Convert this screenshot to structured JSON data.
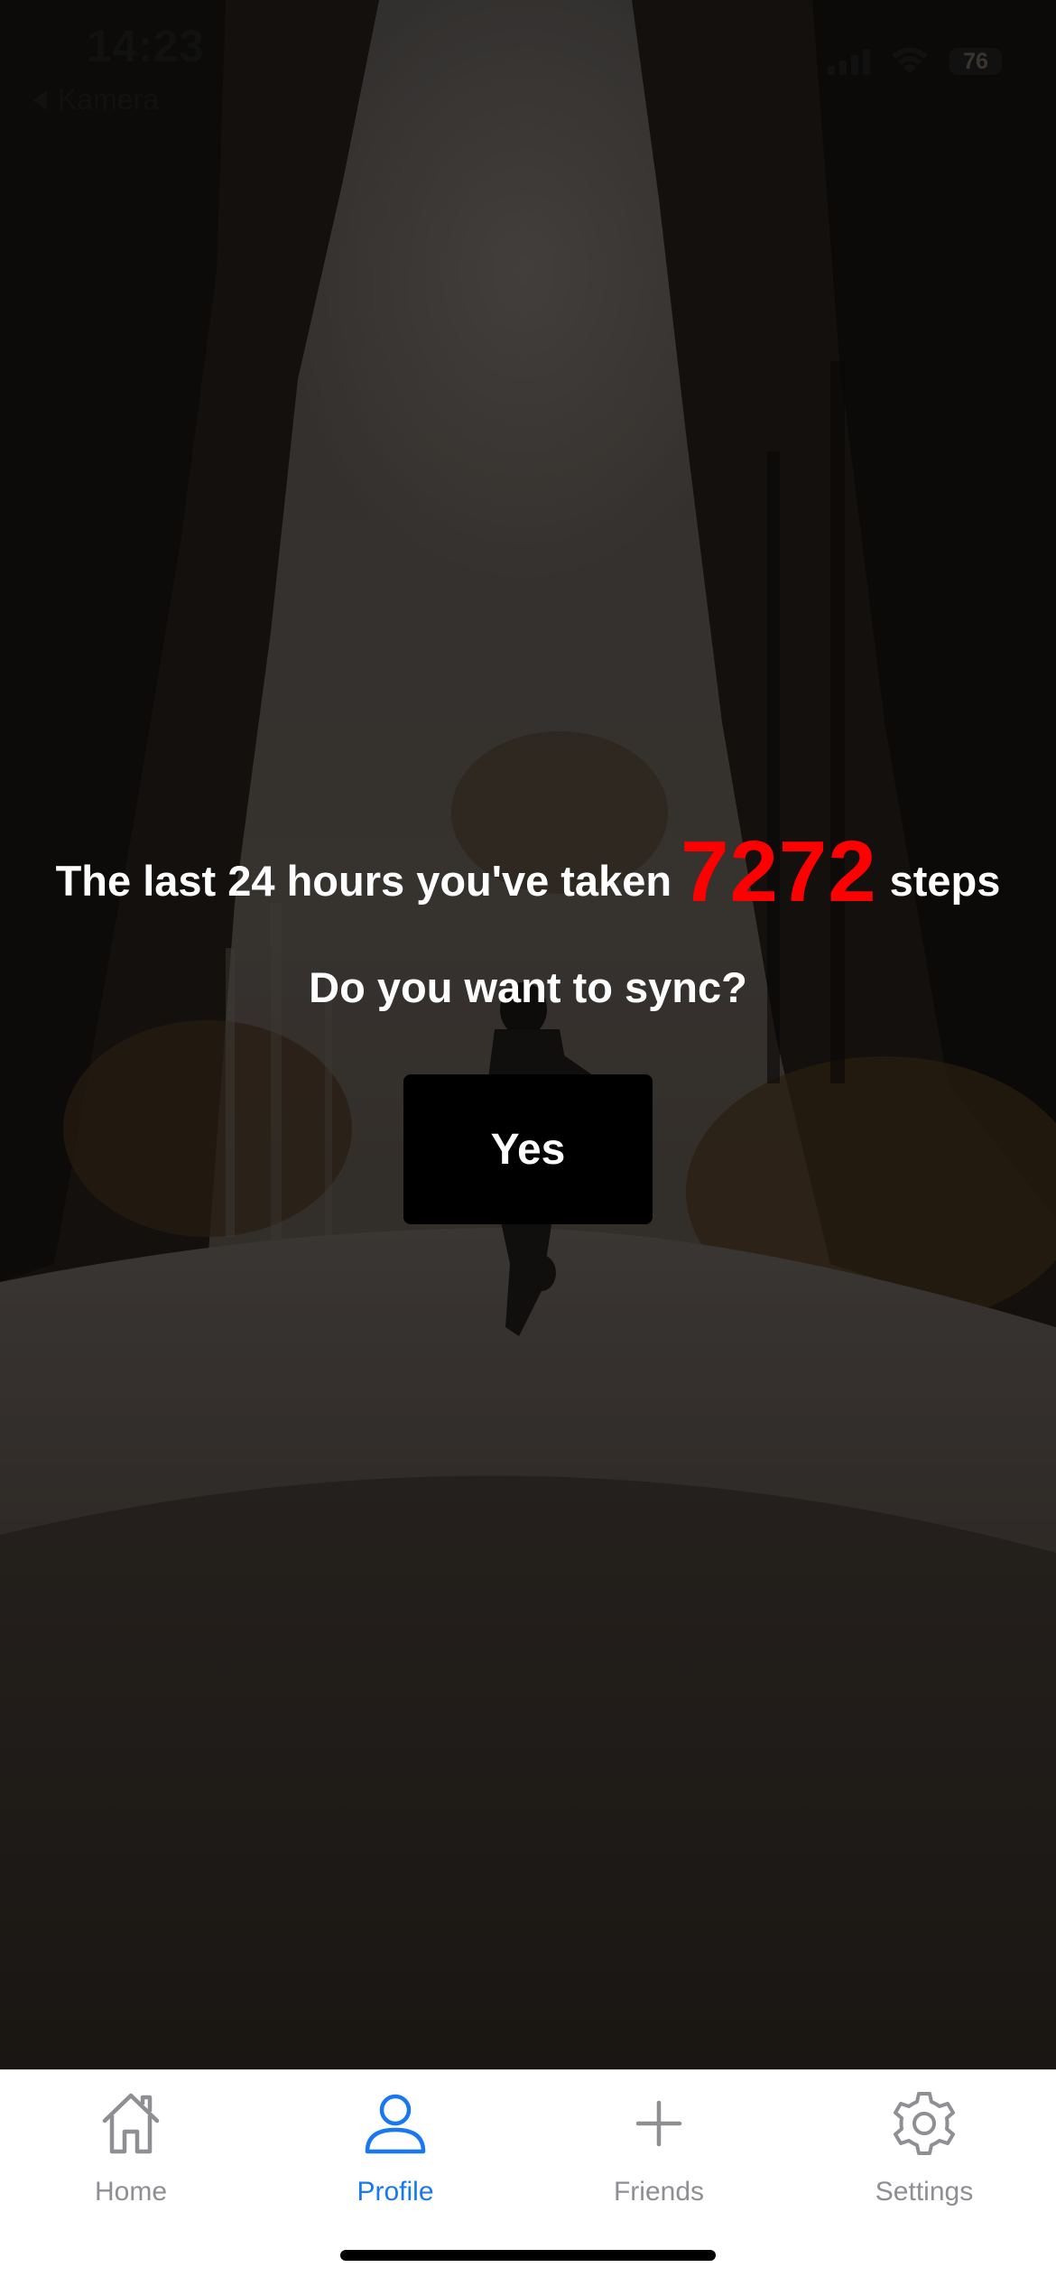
{
  "status_bar": {
    "time": "14:23",
    "back_label": "Kamera",
    "battery": "76"
  },
  "prompt": {
    "prefix": "The last 24 hours you've taken",
    "step_count": "7272",
    "suffix": "steps",
    "question": "Do you want to sync?",
    "yes_label": "Yes"
  },
  "tabs": [
    {
      "label": "Home",
      "icon": "home-icon"
    },
    {
      "label": "Profile",
      "icon": "profile-icon",
      "active": true
    },
    {
      "label": "Friends",
      "icon": "plus-icon"
    },
    {
      "label": "Settings",
      "icon": "gear-icon"
    }
  ],
  "colors": {
    "accent": "#1877f2",
    "step_count": "#ff0000",
    "tab_inactive": "#8e8e93",
    "button": "#000000"
  }
}
